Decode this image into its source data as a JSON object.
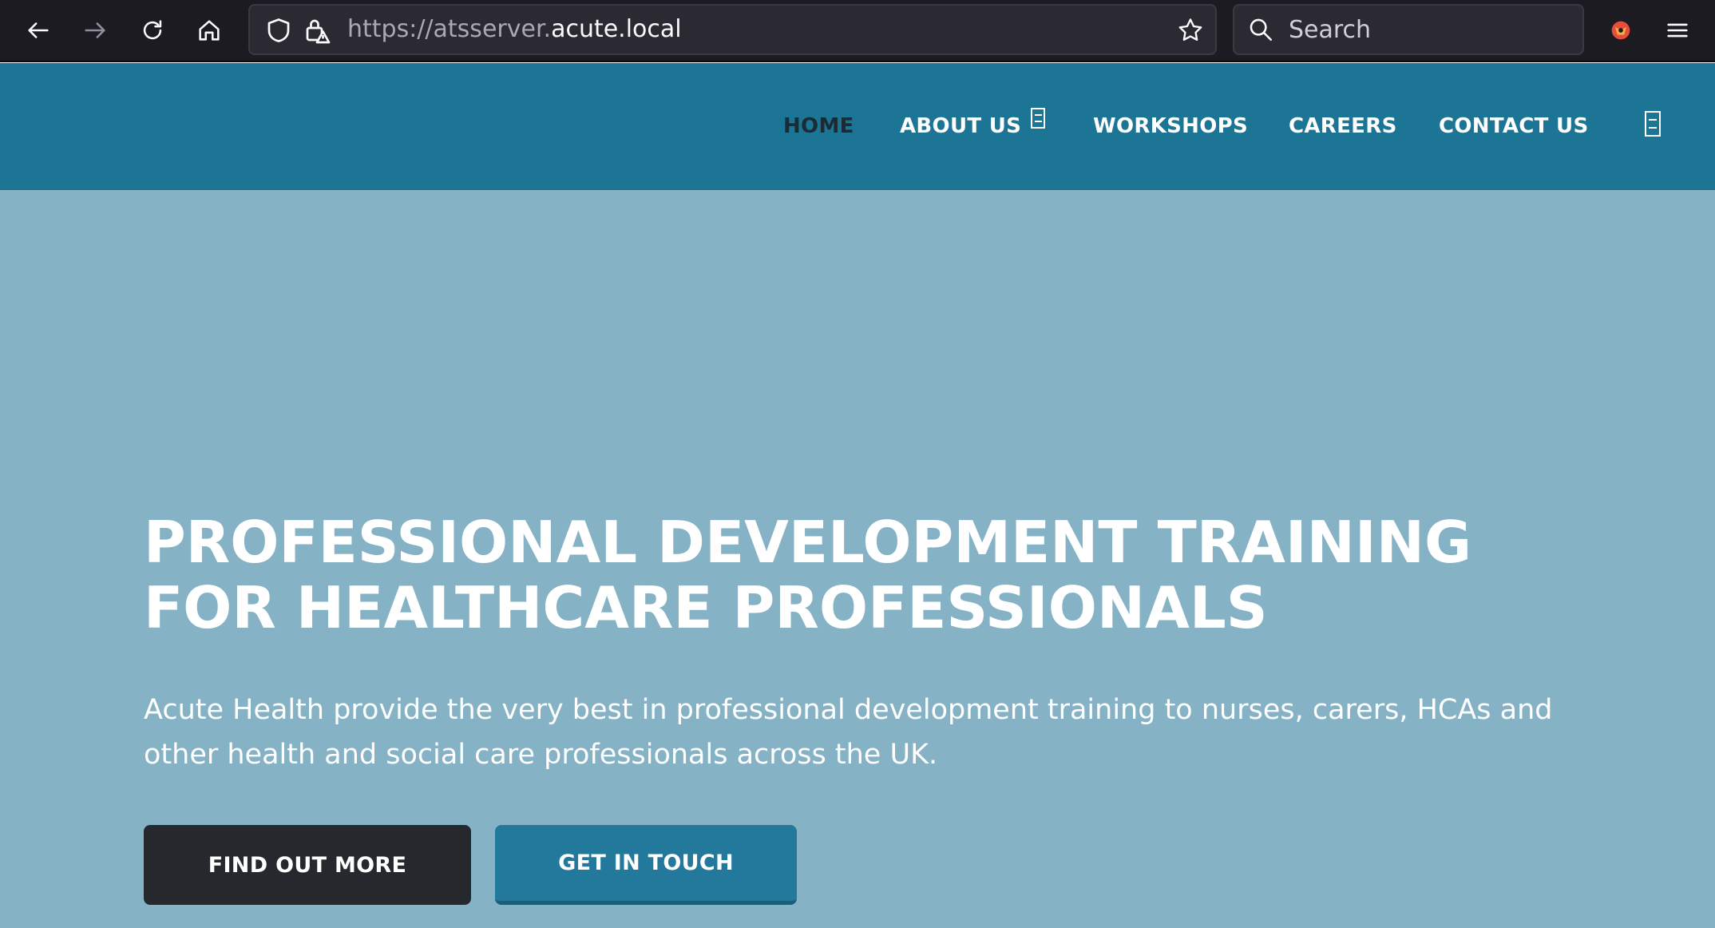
{
  "browser": {
    "url_prefix": "https://atsserver.",
    "url_domain": "acute.local",
    "search_placeholder": "Search"
  },
  "nav": {
    "items": [
      {
        "label": "HOME"
      },
      {
        "label": "ABOUT US"
      },
      {
        "label": "WORKSHOPS"
      },
      {
        "label": "CAREERS"
      },
      {
        "label": "CONTACT US"
      }
    ]
  },
  "hero": {
    "title_line1": "PROFESSIONAL DEVELOPMENT TRAINING",
    "title_line2": "FOR HEALTHCARE PROFESSIONALS",
    "text": "Acute Health provide the very best in professional development training to nurses, carers, HCAs and other health and social care professionals across the UK.",
    "btn_primary": "FIND OUT MORE",
    "btn_secondary": "GET IN TOUCH"
  },
  "colors": {
    "header_bg": "#1d7596",
    "hero_bg": "#85b2c5",
    "dark_button": "#25282c",
    "blue_button": "#22799b",
    "active_nav": "#1b2a33"
  }
}
